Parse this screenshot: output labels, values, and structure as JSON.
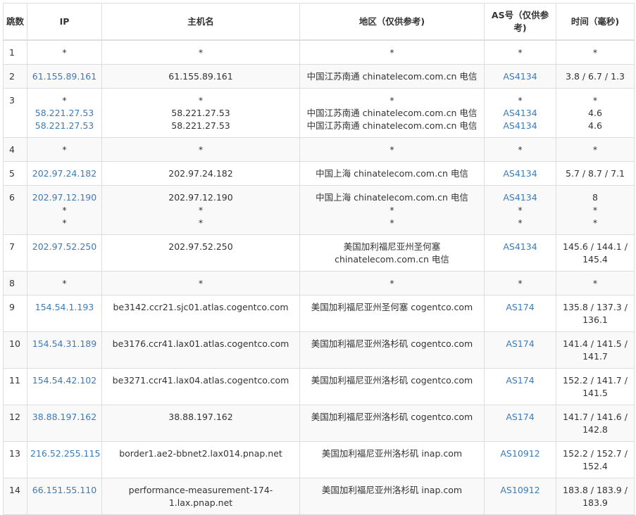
{
  "headers": {
    "hop": "跳数",
    "ip": "IP",
    "hostname": "主机名",
    "region": "地区（仅供参考)",
    "as": "AS号（仅供参考)",
    "time": "时间（毫秒)"
  },
  "rows": [
    {
      "hop": "1",
      "ip": [
        "*"
      ],
      "host": [
        "*"
      ],
      "region": [
        "*"
      ],
      "as": [
        "*"
      ],
      "time": [
        "*"
      ]
    },
    {
      "hop": "2",
      "ip": [
        "61.155.89.161"
      ],
      "host": [
        "61.155.89.161"
      ],
      "region": [
        "中国江苏南通 chinatelecom.com.cn 电信"
      ],
      "as": [
        "AS4134"
      ],
      "time": [
        "3.8 / 6.7 / 1.3"
      ]
    },
    {
      "hop": "3",
      "ip": [
        "*",
        "58.221.27.53",
        "58.221.27.53"
      ],
      "host": [
        "*",
        "58.221.27.53",
        "58.221.27.53"
      ],
      "region": [
        "*",
        "中国江苏南通 chinatelecom.com.cn 电信",
        "中国江苏南通 chinatelecom.com.cn 电信"
      ],
      "as": [
        "*",
        "AS4134",
        "AS4134"
      ],
      "time": [
        "*",
        "4.6",
        "4.6"
      ]
    },
    {
      "hop": "4",
      "ip": [
        "*"
      ],
      "host": [
        "*"
      ],
      "region": [
        "*"
      ],
      "as": [
        "*"
      ],
      "time": [
        "*"
      ]
    },
    {
      "hop": "5",
      "ip": [
        "202.97.24.182"
      ],
      "host": [
        "202.97.24.182"
      ],
      "region": [
        "中国上海 chinatelecom.com.cn 电信"
      ],
      "as": [
        "AS4134"
      ],
      "time": [
        "5.7 / 8.7 / 7.1"
      ]
    },
    {
      "hop": "6",
      "ip": [
        "202.97.12.190",
        "*",
        "*"
      ],
      "host": [
        "202.97.12.190",
        "*",
        "*"
      ],
      "region": [
        "中国上海 chinatelecom.com.cn 电信",
        "*",
        "*"
      ],
      "as": [
        "AS4134",
        "*",
        "*"
      ],
      "time": [
        "8",
        "*",
        "*"
      ]
    },
    {
      "hop": "7",
      "ip": [
        "202.97.52.250"
      ],
      "host": [
        "202.97.52.250"
      ],
      "region": [
        "美国加利福尼亚州圣何塞 chinatelecom.com.cn 电信"
      ],
      "as": [
        "AS4134"
      ],
      "time": [
        "145.6 / 144.1 / 145.4"
      ]
    },
    {
      "hop": "8",
      "ip": [
        "*"
      ],
      "host": [
        "*"
      ],
      "region": [
        "*"
      ],
      "as": [
        "*"
      ],
      "time": [
        "*"
      ]
    },
    {
      "hop": "9",
      "ip": [
        "154.54.1.193"
      ],
      "host": [
        "be3142.ccr21.sjc01.atlas.cogentco.com"
      ],
      "region": [
        "美国加利福尼亚州圣何塞 cogentco.com"
      ],
      "as": [
        "AS174"
      ],
      "time": [
        "135.8 / 137.3 / 136.1"
      ]
    },
    {
      "hop": "10",
      "ip": [
        "154.54.31.189"
      ],
      "host": [
        "be3176.ccr41.lax01.atlas.cogentco.com"
      ],
      "region": [
        "美国加利福尼亚州洛杉矶 cogentco.com"
      ],
      "as": [
        "AS174"
      ],
      "time": [
        "141.4 / 141.5 / 141.7"
      ]
    },
    {
      "hop": "11",
      "ip": [
        "154.54.42.102"
      ],
      "host": [
        "be3271.ccr41.lax04.atlas.cogentco.com"
      ],
      "region": [
        "美国加利福尼亚州洛杉矶 cogentco.com"
      ],
      "as": [
        "AS174"
      ],
      "time": [
        "152.2 / 141.7 / 141.5"
      ]
    },
    {
      "hop": "12",
      "ip": [
        "38.88.197.162"
      ],
      "host": [
        "38.88.197.162"
      ],
      "region": [
        "美国加利福尼亚州洛杉矶 cogentco.com"
      ],
      "as": [
        "AS174"
      ],
      "time": [
        "141.7 / 141.6 / 142.8"
      ]
    },
    {
      "hop": "13",
      "ip": [
        "216.52.255.115"
      ],
      "host": [
        "border1.ae2-bbnet2.lax014.pnap.net"
      ],
      "region": [
        "美国加利福尼亚州洛杉矶 inap.com"
      ],
      "as": [
        "AS10912"
      ],
      "time": [
        "152.2 / 152.7 / 152.4"
      ]
    },
    {
      "hop": "14",
      "ip": [
        "66.151.55.110"
      ],
      "host": [
        "performance-measurement-174-1.lax.pnap.net"
      ],
      "region": [
        "美国加利福尼亚州洛杉矶 inap.com"
      ],
      "as": [
        "AS10912"
      ],
      "time": [
        "183.8 / 183.9 / 183.9"
      ]
    }
  ],
  "colors": {
    "link": "#3a7bb8",
    "text": "#333333",
    "border": "#dddddd",
    "stripe": "#f9f9f9"
  }
}
